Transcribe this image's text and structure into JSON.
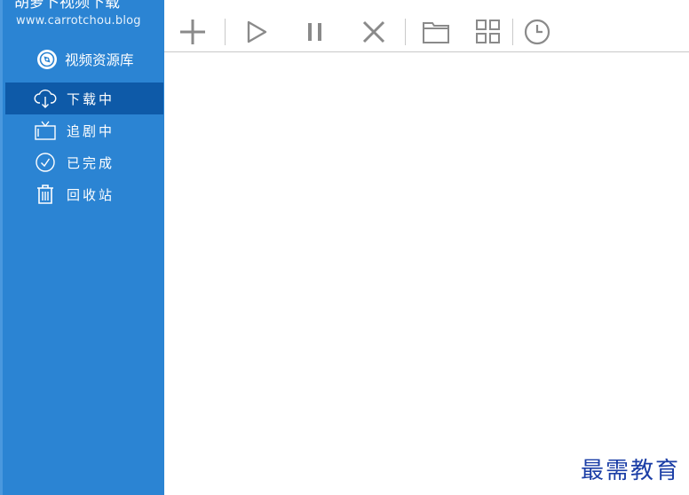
{
  "app": {
    "title": "胡萝卜视频下载",
    "site_url": "www.carrotchou.blog"
  },
  "sidebar": {
    "resource_lib": {
      "label": "视频资源库",
      "icon": "compass-icon"
    },
    "items": [
      {
        "label": "下载中",
        "icon": "cloud-download-icon",
        "active": true
      },
      {
        "label": "追剧中",
        "icon": "tv-icon",
        "active": false
      },
      {
        "label": "已完成",
        "icon": "check-circle-icon",
        "active": false
      },
      {
        "label": "回收站",
        "icon": "trash-icon",
        "active": false
      }
    ]
  },
  "toolbar": {
    "buttons": [
      "add-icon",
      "play-icon",
      "pause-icon",
      "delete-icon",
      "folder-icon",
      "grid-icon",
      "clock-icon"
    ]
  },
  "colors": {
    "sidebar_bg": "#2b84d3",
    "sidebar_active": "#0e5aa8",
    "toolbar_icon": "#8a8a8a",
    "watermark": "#1b3ea6"
  },
  "watermark": {
    "text": "最需教育"
  }
}
